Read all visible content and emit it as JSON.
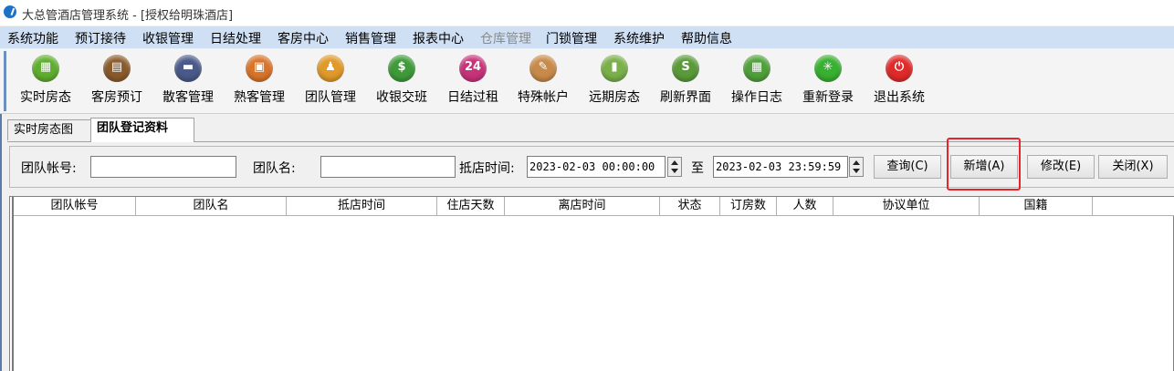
{
  "window": {
    "title": "大总管酒店管理系统 - [授权给明珠酒店]"
  },
  "menu": [
    {
      "label": "系统功能",
      "enabled": true
    },
    {
      "label": "预订接待",
      "enabled": true
    },
    {
      "label": "收银管理",
      "enabled": true
    },
    {
      "label": "日结处理",
      "enabled": true
    },
    {
      "label": "客房中心",
      "enabled": true
    },
    {
      "label": "销售管理",
      "enabled": true
    },
    {
      "label": "报表中心",
      "enabled": true
    },
    {
      "label": "仓库管理",
      "enabled": false
    },
    {
      "label": "门锁管理",
      "enabled": true
    },
    {
      "label": "系统维护",
      "enabled": true
    },
    {
      "label": "帮助信息",
      "enabled": true
    }
  ],
  "toolbar": [
    {
      "label": "实时房态",
      "icon": "grid-icon",
      "glyph": "▦",
      "color": "#5fae2e"
    },
    {
      "label": "客房预订",
      "icon": "booking-icon",
      "glyph": "▤",
      "color": "#8a5a2b"
    },
    {
      "label": "散客管理",
      "icon": "guest-card-icon",
      "glyph": "▬",
      "color": "#4a5a88"
    },
    {
      "label": "熟客管理",
      "icon": "member-card-icon",
      "glyph": "▣",
      "color": "#d9742a"
    },
    {
      "label": "团队管理",
      "icon": "team-icon",
      "glyph": "♟",
      "color": "#e09a2a"
    },
    {
      "label": "收银交班",
      "icon": "cashier-icon",
      "glyph": "$",
      "color": "#3f9a3a"
    },
    {
      "label": "日结过租",
      "icon": "day-close-icon",
      "glyph": "24",
      "color": "#c8327a"
    },
    {
      "label": "特殊帐户",
      "icon": "tag-icon",
      "glyph": "✎",
      "color": "#c88a4a"
    },
    {
      "label": "远期房态",
      "icon": "chart-icon",
      "glyph": "▮",
      "color": "#7ab04a"
    },
    {
      "label": "刷新界面",
      "icon": "refresh-icon",
      "glyph": "S",
      "color": "#5a9a3a"
    },
    {
      "label": "操作日志",
      "icon": "calendar-icon",
      "glyph": "▦",
      "color": "#4fa03a"
    },
    {
      "label": "重新登录",
      "icon": "relogin-icon",
      "glyph": "✳",
      "color": "#38b030"
    },
    {
      "label": "退出系统",
      "icon": "power-icon",
      "glyph": "⏻",
      "color": "#e02a2a"
    }
  ],
  "tabs": [
    {
      "label": "实时房态图",
      "active": false
    },
    {
      "label": "团队登记资料",
      "active": true
    }
  ],
  "filter": {
    "team_account_label": "团队帐号:",
    "team_account_value": "",
    "team_name_label": "团队名:",
    "team_name_value": "",
    "arrival_label": "抵店时间:",
    "arrival_from": "2023-02-03 00:00:00",
    "to_label": "至",
    "arrival_to": "2023-02-03 23:59:59",
    "query_button": "查询(C)",
    "add_button": "新增(A)",
    "edit_button": "修改(E)",
    "close_button": "关闭(X)"
  },
  "grid": {
    "columns": [
      "团队帐号",
      "团队名",
      "抵店时间",
      "住店天数",
      "离店时间",
      "状态",
      "订房数",
      "人数",
      "协议单位",
      "国籍"
    ],
    "rows": []
  },
  "colors": {
    "menubar": "#cfe0f5",
    "highlight": "#e8232a"
  }
}
